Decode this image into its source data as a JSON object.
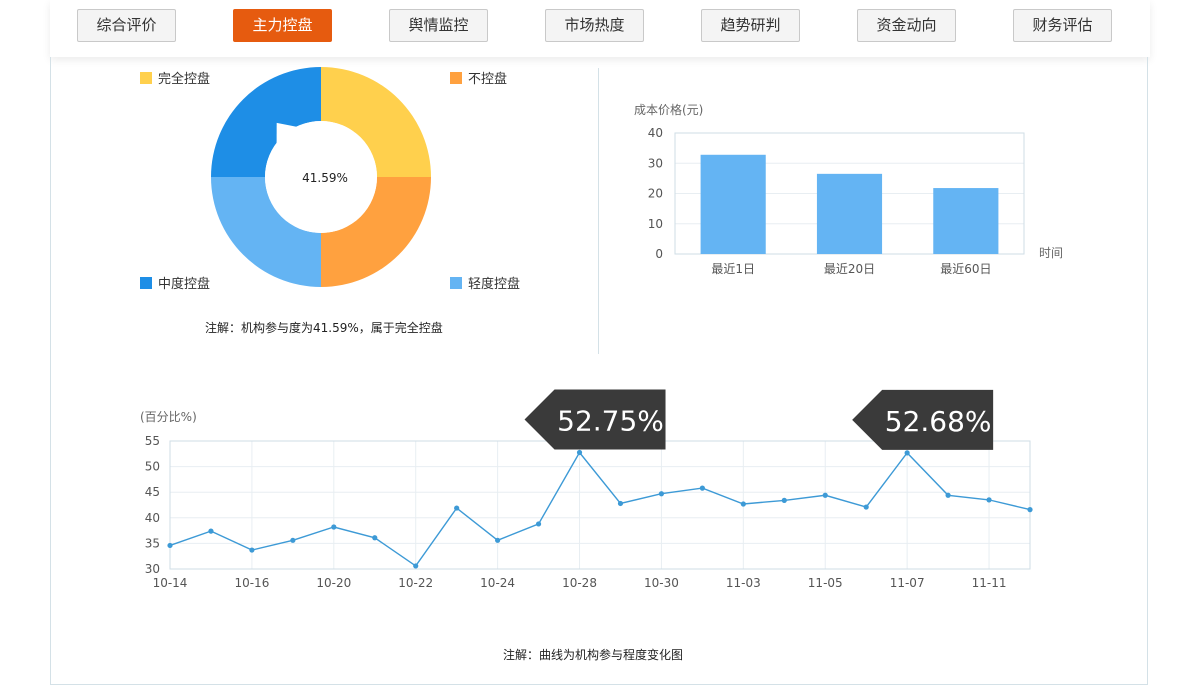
{
  "tabs": [
    {
      "label": "综合评价",
      "active": false
    },
    {
      "label": "主力控盘",
      "active": true
    },
    {
      "label": "舆情监控",
      "active": false
    },
    {
      "label": "市场热度",
      "active": false
    },
    {
      "label": "趋势研判",
      "active": false
    },
    {
      "label": "资金动向",
      "active": false
    },
    {
      "label": "财务评估",
      "active": false
    }
  ],
  "colors": {
    "accent": "#e65b0f",
    "line": "#3d9ad6",
    "bar": "#64b4f3"
  },
  "pie": {
    "center_label": "41.59%",
    "legend": [
      {
        "label": "完全控盘",
        "color": "#ffd04d"
      },
      {
        "label": "不控盘",
        "color": "#ffa13f"
      },
      {
        "label": "中度控盘",
        "color": "#1e8ee6"
      },
      {
        "label": "轻度控盘",
        "color": "#64b4f3"
      }
    ],
    "note": "注解：机构参与度为41.59%，属于完全控盘"
  },
  "chart_data": [
    {
      "type": "pie",
      "categories": [
        "完全控盘",
        "不控盘",
        "轻度控盘",
        "中度控盘"
      ],
      "values": [
        25,
        25,
        25,
        25
      ],
      "indicator_value": 41.59,
      "center_label": "41.59%"
    },
    {
      "type": "bar",
      "categories": [
        "最近1日",
        "最近20日",
        "最近60日"
      ],
      "values": [
        32.8,
        26.5,
        21.8
      ],
      "ylabel": "成本价格(元)",
      "xlabel": "时间",
      "ylim": [
        0,
        40
      ],
      "yticks": [
        0,
        10,
        20,
        30,
        40
      ],
      "grid": true
    },
    {
      "type": "line",
      "ylabel": "(百分比%)",
      "ylim": [
        30,
        55
      ],
      "yticks": [
        30,
        35,
        40,
        45,
        50,
        55
      ],
      "x_tick_labels": [
        "10-14",
        "10-16",
        "10-20",
        "10-22",
        "10-24",
        "10-28",
        "10-30",
        "11-03",
        "11-05",
        "11-07",
        "11-11"
      ],
      "values": [
        34.6,
        37.4,
        33.7,
        35.6,
        38.2,
        36.1,
        30.6,
        41.9,
        35.6,
        38.8,
        52.75,
        42.8,
        44.7,
        45.8,
        42.7,
        43.4,
        44.4,
        42.1,
        52.68,
        44.4,
        43.5,
        41.6
      ],
      "grid": true,
      "annotations": [
        {
          "point_index": 10,
          "label": "52.75%"
        },
        {
          "point_index": 18,
          "label": "52.68%"
        }
      ],
      "note": "注解：曲线为机构参与程度变化图"
    }
  ]
}
